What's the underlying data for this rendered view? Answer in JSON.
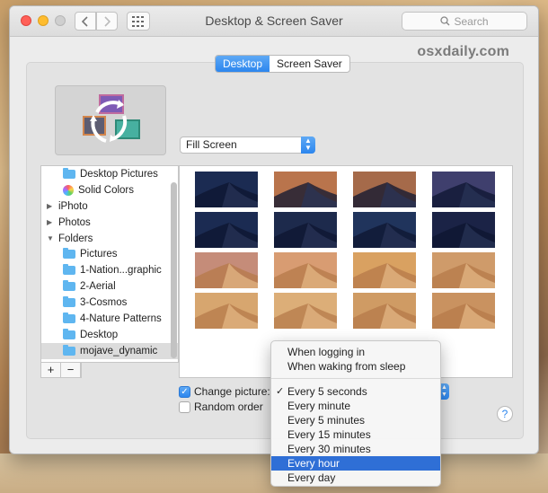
{
  "window": {
    "title": "Desktop & Screen Saver"
  },
  "search": {
    "placeholder": "Search"
  },
  "watermark": "osxdaily.com",
  "tabs": [
    {
      "label": "Desktop",
      "active": true
    },
    {
      "label": "Screen Saver",
      "active": false
    }
  ],
  "fill_option": "Fill Screen",
  "sidebar": {
    "items": [
      {
        "label": "Desktop Pictures",
        "level": 2,
        "icon": "folder-icon"
      },
      {
        "label": "Solid Colors",
        "level": 2,
        "icon": "color-wheel-icon"
      },
      {
        "label": "iPhoto",
        "level": 1,
        "icon": "disclosure-right-icon"
      },
      {
        "label": "Photos",
        "level": 1,
        "icon": "disclosure-right-icon"
      },
      {
        "label": "Folders",
        "level": 1,
        "icon": "disclosure-down-icon"
      },
      {
        "label": "Pictures",
        "level": 2,
        "icon": "folder-icon"
      },
      {
        "label": "1-Nation...graphic",
        "level": 2,
        "icon": "folder-icon"
      },
      {
        "label": "2-Aerial",
        "level": 2,
        "icon": "folder-icon"
      },
      {
        "label": "3-Cosmos",
        "level": 2,
        "icon": "folder-icon"
      },
      {
        "label": "4-Nature Patterns",
        "level": 2,
        "icon": "folder-icon"
      },
      {
        "label": "Desktop",
        "level": 2,
        "icon": "folder-icon"
      },
      {
        "label": "mojave_dynamic",
        "level": 2,
        "icon": "folder-icon",
        "selected": true
      }
    ],
    "add_label": "+",
    "remove_label": "−"
  },
  "controls": {
    "change_picture_label": "Change picture:",
    "change_picture_checked": true,
    "random_order_label": "Random order",
    "random_order_checked": false,
    "help_label": "?"
  },
  "interval_menu": {
    "groups": [
      [
        "When logging in",
        "When waking from sleep"
      ],
      [
        "Every 5 seconds",
        "Every minute",
        "Every 5 minutes",
        "Every 15 minutes",
        "Every 30 minutes",
        "Every hour",
        "Every day"
      ]
    ],
    "selected": "Every 5 seconds",
    "highlighted": "Every hour"
  },
  "thumbnails_palette": [
    [
      "#1b2b52",
      "#b9744c",
      "#a56a4a",
      "#3f3f6d"
    ],
    [
      "#1b2b52",
      "#1d2a4c",
      "#20345c",
      "#1b2346"
    ],
    [
      "#c58c79",
      "#d89c72",
      "#d9a161",
      "#cf9b6a"
    ],
    [
      "#d7a66f",
      "#dcae78",
      "#cf9b64",
      "#c99260"
    ]
  ],
  "colors": {
    "accent": "#2c86ee",
    "menu_highlight": "#2f6fd6"
  }
}
